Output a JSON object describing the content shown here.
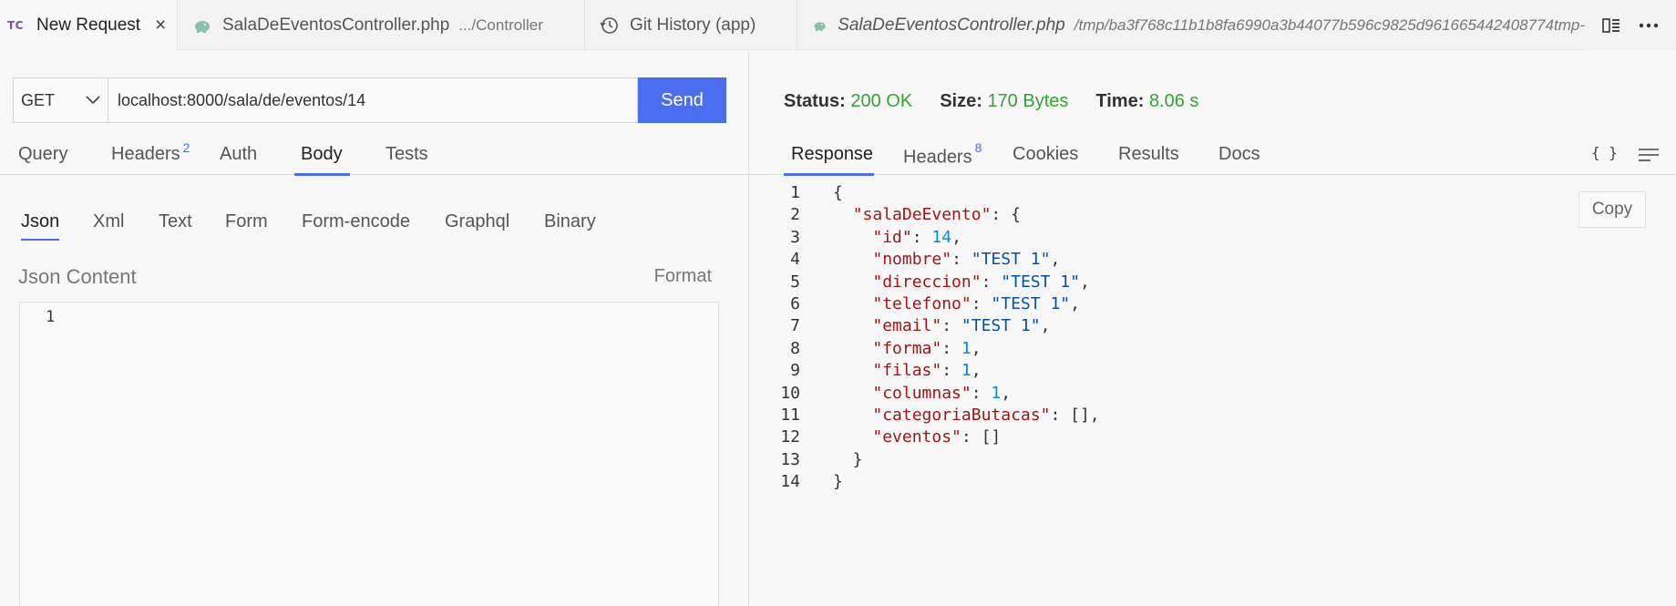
{
  "tabs": [
    {
      "badge": "TC",
      "label": "New Request",
      "close": "×"
    },
    {
      "label": "SalaDeEventosController.php",
      "desc": ".../Controller"
    },
    {
      "label": "Git History (app)"
    },
    {
      "label": "SalaDeEventosController.php",
      "desc": "/tmp/ba3f768c11b1b8fa6990a3b44077b596c9825d961665442408774tmp-"
    }
  ],
  "request": {
    "method": "GET",
    "url": "localhost:8000/sala/de/eventos/14",
    "send_label": "Send"
  },
  "request_tabs": [
    {
      "label": "Query"
    },
    {
      "label": "Headers",
      "count": "2"
    },
    {
      "label": "Auth"
    },
    {
      "label": "Body"
    },
    {
      "label": "Tests"
    }
  ],
  "body_tabs": [
    "Json",
    "Xml",
    "Text",
    "Form",
    "Form-encode",
    "Graphql",
    "Binary"
  ],
  "body": {
    "content_label": "Json Content",
    "format_label": "Format",
    "line_number": "1"
  },
  "response": {
    "status_label": "Status:",
    "status_value": "200 OK",
    "size_label": "Size:",
    "size_value": "170 Bytes",
    "time_label": "Time:",
    "time_value": "8.06 s",
    "copy_label": "Copy",
    "braces_label": "{ }"
  },
  "response_tabs": [
    {
      "label": "Response"
    },
    {
      "label": "Headers",
      "count": "8"
    },
    {
      "label": "Cookies"
    },
    {
      "label": "Results"
    },
    {
      "label": "Docs"
    }
  ],
  "response_code": [
    {
      "no": "1",
      "tokens": [
        {
          "t": "{",
          "c": "p"
        }
      ]
    },
    {
      "no": "2",
      "tokens": [
        {
          "t": "  ",
          "c": "p"
        },
        {
          "t": "\"salaDeEvento\"",
          "c": "k"
        },
        {
          "t": ": {",
          "c": "p"
        }
      ]
    },
    {
      "no": "3",
      "tokens": [
        {
          "t": "    ",
          "c": "p"
        },
        {
          "t": "\"id\"",
          "c": "k"
        },
        {
          "t": ": ",
          "c": "p"
        },
        {
          "t": "14",
          "c": "n"
        },
        {
          "t": ",",
          "c": "p"
        }
      ]
    },
    {
      "no": "4",
      "tokens": [
        {
          "t": "    ",
          "c": "p"
        },
        {
          "t": "\"nombre\"",
          "c": "k"
        },
        {
          "t": ": ",
          "c": "p"
        },
        {
          "t": "\"TEST 1\"",
          "c": "s"
        },
        {
          "t": ",",
          "c": "p"
        }
      ]
    },
    {
      "no": "5",
      "tokens": [
        {
          "t": "    ",
          "c": "p"
        },
        {
          "t": "\"direccion\"",
          "c": "k"
        },
        {
          "t": ": ",
          "c": "p"
        },
        {
          "t": "\"TEST 1\"",
          "c": "s"
        },
        {
          "t": ",",
          "c": "p"
        }
      ]
    },
    {
      "no": "6",
      "tokens": [
        {
          "t": "    ",
          "c": "p"
        },
        {
          "t": "\"telefono\"",
          "c": "k"
        },
        {
          "t": ": ",
          "c": "p"
        },
        {
          "t": "\"TEST 1\"",
          "c": "s"
        },
        {
          "t": ",",
          "c": "p"
        }
      ]
    },
    {
      "no": "7",
      "tokens": [
        {
          "t": "    ",
          "c": "p"
        },
        {
          "t": "\"email\"",
          "c": "k"
        },
        {
          "t": ": ",
          "c": "p"
        },
        {
          "t": "\"TEST 1\"",
          "c": "s"
        },
        {
          "t": ",",
          "c": "p"
        }
      ]
    },
    {
      "no": "8",
      "tokens": [
        {
          "t": "    ",
          "c": "p"
        },
        {
          "t": "\"forma\"",
          "c": "k"
        },
        {
          "t": ": ",
          "c": "p"
        },
        {
          "t": "1",
          "c": "n"
        },
        {
          "t": ",",
          "c": "p"
        }
      ]
    },
    {
      "no": "9",
      "tokens": [
        {
          "t": "    ",
          "c": "p"
        },
        {
          "t": "\"filas\"",
          "c": "k"
        },
        {
          "t": ": ",
          "c": "p"
        },
        {
          "t": "1",
          "c": "n"
        },
        {
          "t": ",",
          "c": "p"
        }
      ]
    },
    {
      "no": "10",
      "tokens": [
        {
          "t": "    ",
          "c": "p"
        },
        {
          "t": "\"columnas\"",
          "c": "k"
        },
        {
          "t": ": ",
          "c": "p"
        },
        {
          "t": "1",
          "c": "n"
        },
        {
          "t": ",",
          "c": "p"
        }
      ]
    },
    {
      "no": "11",
      "tokens": [
        {
          "t": "    ",
          "c": "p"
        },
        {
          "t": "\"categoriaButacas\"",
          "c": "k"
        },
        {
          "t": ": [],",
          "c": "p"
        }
      ]
    },
    {
      "no": "12",
      "tokens": [
        {
          "t": "    ",
          "c": "p"
        },
        {
          "t": "\"eventos\"",
          "c": "k"
        },
        {
          "t": ": []",
          "c": "p"
        }
      ]
    },
    {
      "no": "13",
      "tokens": [
        {
          "t": "  }",
          "c": "p"
        }
      ]
    },
    {
      "no": "14",
      "tokens": [
        {
          "t": "}",
          "c": "p"
        }
      ]
    }
  ],
  "icons": {
    "php": "php-elephant-icon",
    "history": "history-icon",
    "split": "split-editor-icon",
    "more": "more-icon",
    "chevron": "chevron-down-icon",
    "wrap": "wrap-lines-icon"
  },
  "colors": {
    "accent": "#4b6ef0",
    "status_ok": "#31a531",
    "json_key": "#a31515",
    "json_string": "#0451a5",
    "json_number": "#098ad6",
    "tc_badge": "#7a4fa8"
  }
}
